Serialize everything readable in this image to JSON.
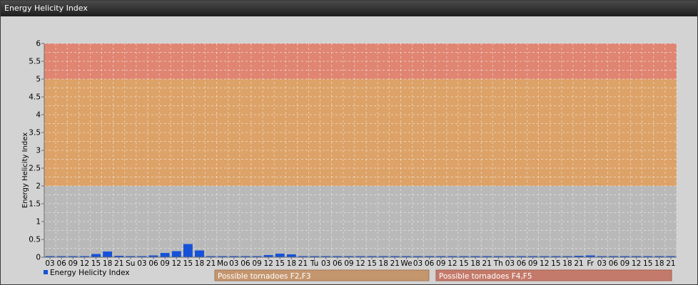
{
  "window": {
    "title": "Energy Helicity Index"
  },
  "colors": {
    "bar": "#1552d8",
    "zone_low": "#b9b9b9",
    "zone_mid": "#dda267",
    "zone_high": "#e08572",
    "grid": "#f2f2f2",
    "legend_mid": "#c4966e",
    "legend_high": "#c47a6a"
  },
  "chart_data": {
    "type": "bar",
    "title": "Energy Helicity Index",
    "ylabel": "Energy Helicity Index",
    "xlabel": "",
    "ylim": [
      0,
      6
    ],
    "yticks": [
      "0",
      "0.5",
      "1",
      "1.5",
      "2",
      "2.5",
      "3",
      "3.5",
      "4",
      "4.5",
      "5",
      "5.5",
      "6"
    ],
    "grid": true,
    "categories": [
      "03",
      "06",
      "09",
      "12",
      "15",
      "18",
      "21",
      "Su",
      "03",
      "06",
      "09",
      "12",
      "15",
      "18",
      "21",
      "Mo",
      "03",
      "06",
      "09",
      "12",
      "15",
      "18",
      "21",
      "Tu",
      "03",
      "06",
      "09",
      "12",
      "15",
      "18",
      "21",
      "We",
      "03",
      "06",
      "09",
      "12",
      "15",
      "18",
      "21",
      "Th",
      "03",
      "06",
      "09",
      "12",
      "15",
      "18",
      "21",
      "Fr",
      "03",
      "06",
      "09",
      "12",
      "15",
      "18",
      "21"
    ],
    "series": [
      {
        "name": "Energy Helicity Index",
        "values": [
          0.01,
          0.01,
          0.0,
          0.02,
          0.09,
          0.16,
          0.04,
          0.01,
          0.01,
          0.05,
          0.12,
          0.17,
          0.37,
          0.19,
          0.02,
          0.01,
          0.01,
          0.03,
          0.03,
          0.06,
          0.1,
          0.08,
          0.02,
          0.01,
          0.01,
          0.01,
          0.01,
          0.02,
          0.02,
          0.01,
          0.01,
          0.01,
          0.01,
          0.01,
          0.01,
          0.01,
          0.01,
          0.01,
          0.01,
          0.01,
          0.01,
          0.01,
          0.01,
          0.01,
          0.02,
          0.02,
          0.04,
          0.05,
          0.02,
          0.01,
          0.01,
          0.01,
          0.01,
          0.01,
          0.01
        ]
      }
    ],
    "zones": [
      {
        "from": 0,
        "to": 2,
        "color": "#b9b9b9"
      },
      {
        "from": 2,
        "to": 5,
        "color": "#dda267",
        "label": "Possible tornadoes F2,F3"
      },
      {
        "from": 5,
        "to": 6,
        "color": "#e08572",
        "label": "Possible tornadoes F4,F5"
      }
    ],
    "legend": {
      "position": "bottom-left",
      "series_label": "Energy Helicity Index",
      "zone_labels": [
        "Possible tornadoes F2,F3",
        "Possible tornadoes F4,F5"
      ]
    }
  }
}
